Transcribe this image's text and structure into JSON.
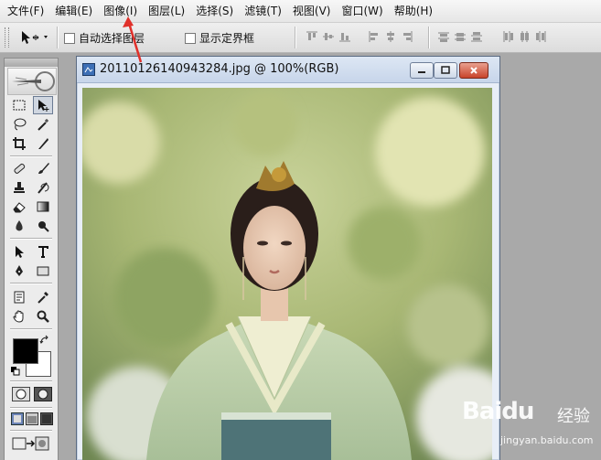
{
  "menu": [
    {
      "label": "文件(F)"
    },
    {
      "label": "编辑(E)"
    },
    {
      "label": "图像(I)"
    },
    {
      "label": "图层(L)"
    },
    {
      "label": "选择(S)"
    },
    {
      "label": "滤镜(T)"
    },
    {
      "label": "视图(V)"
    },
    {
      "label": "窗口(W)"
    },
    {
      "label": "帮助(H)"
    }
  ],
  "options": {
    "auto_select_layer": {
      "label": "自动选择图层",
      "checked": false
    },
    "show_bounding_box": {
      "label": "显示定界框",
      "checked": false
    }
  },
  "document": {
    "title": "20110126140943284.jpg @ 100%(RGB)"
  },
  "watermark": {
    "brand": "Baidu",
    "suffix": "经验",
    "url": "jingyan.baidu.com"
  },
  "colors": {
    "foreground": "#000000",
    "background": "#ffffff",
    "annotation_arrow": "#e0302a"
  }
}
